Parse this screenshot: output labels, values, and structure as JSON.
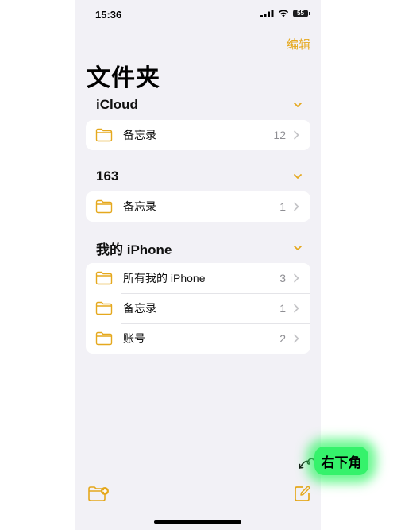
{
  "status_bar": {
    "time": "15:36",
    "battery": "55"
  },
  "header": {
    "edit_label": "编辑",
    "title": "文件夹"
  },
  "sections": [
    {
      "title": "iCloud",
      "folders": [
        {
          "name": "备忘录",
          "count": "12"
        }
      ]
    },
    {
      "title": "163",
      "folders": [
        {
          "name": "备忘录",
          "count": "1"
        }
      ]
    },
    {
      "title": "我的 iPhone",
      "folders": [
        {
          "name": "所有我的 iPhone",
          "count": "3"
        },
        {
          "name": "备忘录",
          "count": "1"
        },
        {
          "name": "账号",
          "count": "2"
        }
      ]
    }
  ],
  "annotation": {
    "text": "右下角"
  },
  "colors": {
    "accent": "#e5a81d",
    "background": "#f2f1f6",
    "highlight": "#35f26b"
  },
  "icons": {
    "folder": "folder-icon",
    "new_folder": "new-folder-icon",
    "compose": "compose-icon",
    "chevron_down": "chevron-down-icon",
    "chevron_right": "chevron-right-icon"
  }
}
